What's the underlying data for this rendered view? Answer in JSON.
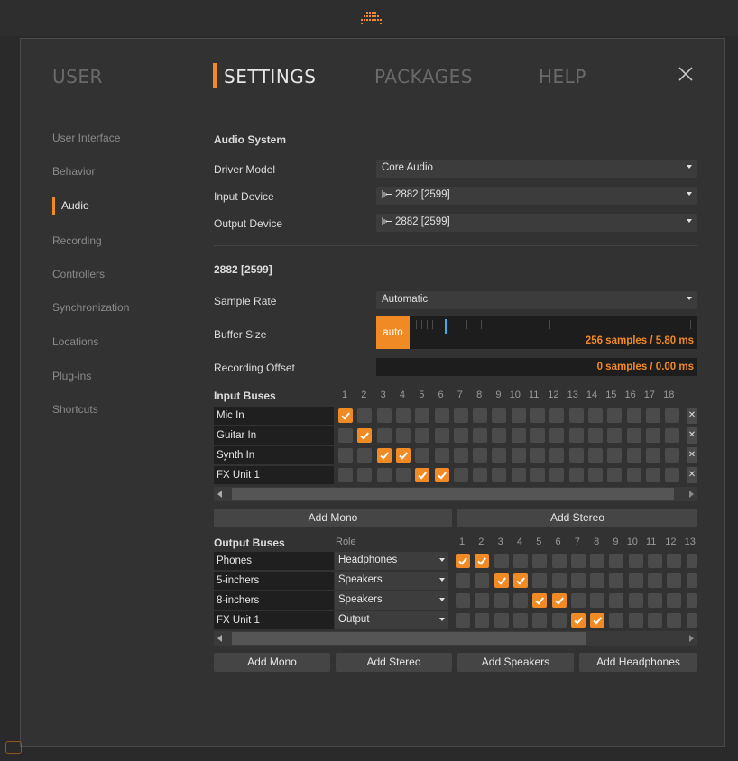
{
  "nav": {
    "user": "USER",
    "settings": "SETTINGS",
    "packages": "PACKAGES",
    "help": "HELP"
  },
  "sidebar": [
    {
      "label": "User Interface"
    },
    {
      "label": "Behavior"
    },
    {
      "label": "Audio",
      "active": true
    },
    {
      "label": "Recording"
    },
    {
      "label": "Controllers"
    },
    {
      "label": "Synchronization"
    },
    {
      "label": "Locations"
    },
    {
      "label": "Plug-ins"
    },
    {
      "label": "Shortcuts"
    }
  ],
  "audio_system": {
    "heading": "Audio System",
    "driver_label": "Driver Model",
    "driver_value": "Core Audio",
    "input_label": "Input Device",
    "input_value": "2882 [2599]",
    "output_label": "Output Device",
    "output_value": "2882 [2599]"
  },
  "device": {
    "heading": "2882 [2599]",
    "sample_rate_label": "Sample Rate",
    "sample_rate_value": "Automatic",
    "buffer_label": "Buffer Size",
    "buffer_auto": "auto",
    "buffer_value": "256 samples / 5.80 ms",
    "offset_label": "Recording Offset",
    "offset_value": "0 samples / 0.00 ms"
  },
  "input_buses": {
    "heading": "Input Buses",
    "channels": [
      "1",
      "2",
      "3",
      "4",
      "5",
      "6",
      "7",
      "8",
      "9",
      "10",
      "11",
      "12",
      "13",
      "14",
      "15",
      "16",
      "17",
      "18"
    ],
    "rows": [
      {
        "name": "Mic In",
        "on": [
          1
        ]
      },
      {
        "name": "Guitar In",
        "on": [
          2
        ]
      },
      {
        "name": "Synth In",
        "on": [
          3,
          4
        ]
      },
      {
        "name": "FX Unit 1",
        "on": [
          5,
          6
        ]
      }
    ],
    "add_mono": "Add Mono",
    "add_stereo": "Add Stereo"
  },
  "output_buses": {
    "heading": "Output Buses",
    "role_heading": "Role",
    "channels": [
      "1",
      "2",
      "3",
      "4",
      "5",
      "6",
      "7",
      "8",
      "9",
      "10",
      "11",
      "12",
      "13"
    ],
    "rows": [
      {
        "name": "Phones",
        "role": "Headphones",
        "on": [
          1,
          2
        ]
      },
      {
        "name": "5-inchers",
        "role": "Speakers",
        "on": [
          3,
          4
        ]
      },
      {
        "name": "8-inchers",
        "role": "Speakers",
        "on": [
          5,
          6
        ]
      },
      {
        "name": "FX Unit 1",
        "role": "Output",
        "on": [
          7,
          8
        ]
      }
    ],
    "add_mono": "Add Mono",
    "add_stereo": "Add Stereo",
    "add_speakers": "Add Speakers",
    "add_headphones": "Add Headphones"
  },
  "colors": {
    "accent": "#f08a24",
    "background": "#323232"
  }
}
